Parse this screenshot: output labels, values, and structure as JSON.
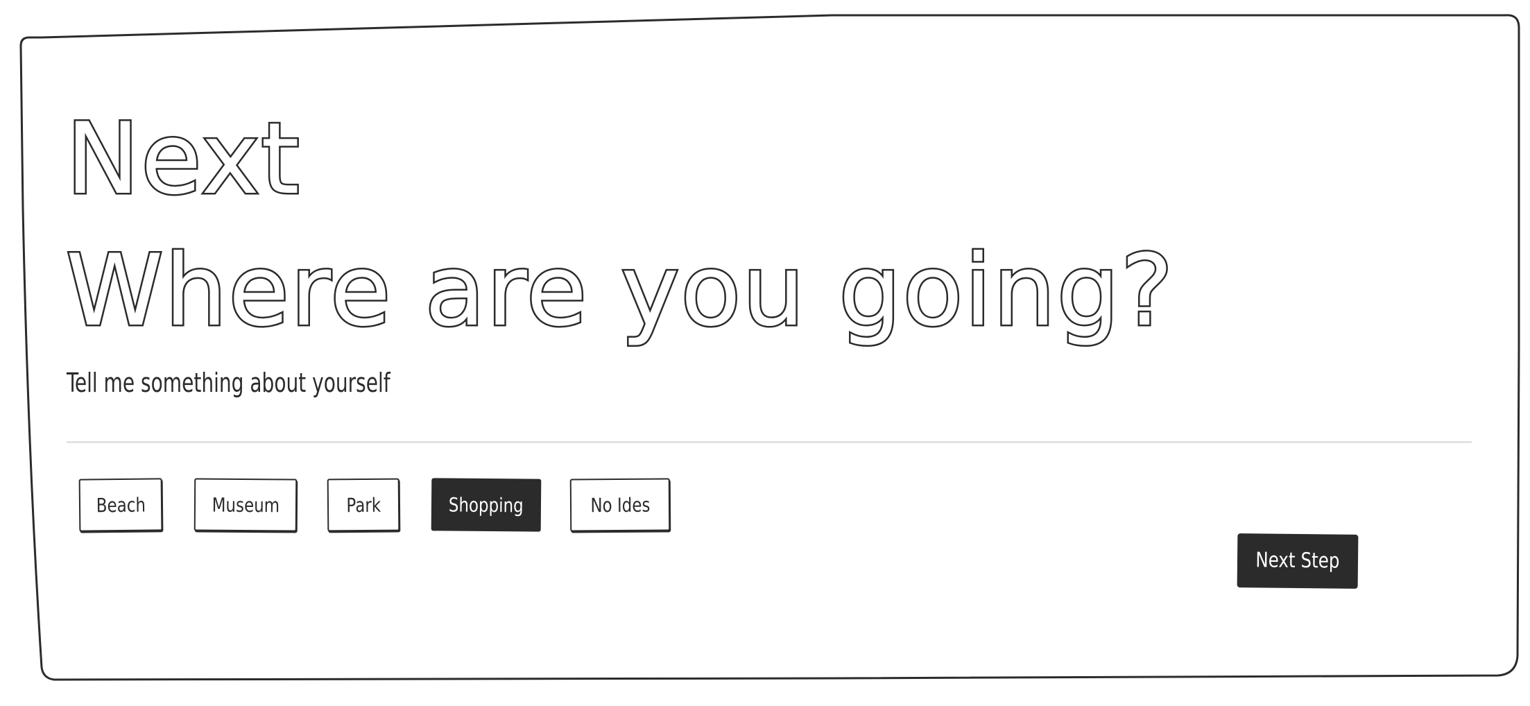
{
  "header": {
    "kicker": "Next",
    "title": "Where are you going?",
    "subtitle": "Tell me something about yourself"
  },
  "options": [
    {
      "label": "Beach",
      "selected": false
    },
    {
      "label": "Museum",
      "selected": false
    },
    {
      "label": "Park",
      "selected": false
    },
    {
      "label": "Shopping",
      "selected": true
    },
    {
      "label": "No Ides",
      "selected": false
    }
  ],
  "actions": {
    "next_label": "Next Step"
  },
  "colors": {
    "ink": "#2b2b2b",
    "background": "#ffffff",
    "divider": "#e2e2e2"
  }
}
